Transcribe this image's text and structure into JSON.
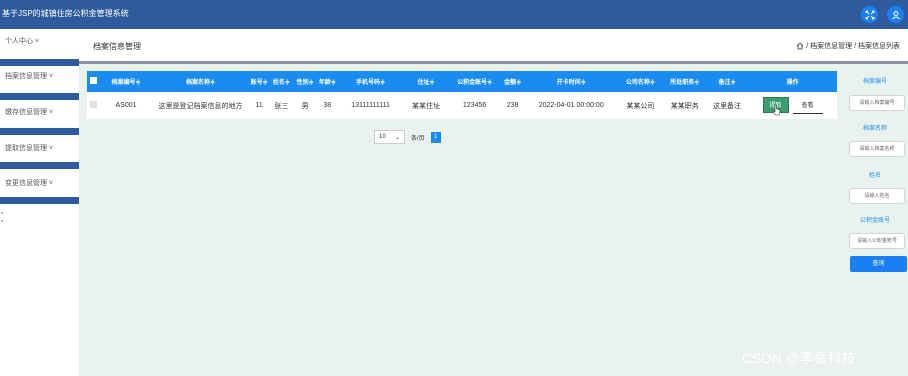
{
  "app": {
    "title": "基于JSP的城镇住房公积金管理系统"
  },
  "sidebar": {
    "items": [
      {
        "label": "个人中心 ˅"
      },
      {
        "label": "档案信息管理 ˅"
      },
      {
        "label": "缴存信息管理 ˅"
      },
      {
        "label": "提取信息管理 ˅"
      },
      {
        "label": "变更信息管理 ˅"
      }
    ]
  },
  "header": {
    "title": "档案信息管理",
    "breadcrumb": "/ 档案信息管理 / 档案信息列表"
  },
  "table": {
    "headers": [
      "档案编号≑",
      "档案名称≑",
      "账号≑",
      "姓名≑",
      "性别≑",
      "年龄≑",
      "手机号码≑",
      "住址≑",
      "公积金账号≑",
      "金额≑",
      "开卡时间≑",
      "公司名称≑",
      "所处职务≑",
      "备注≑",
      "操作"
    ],
    "rows": [
      [
        "AS001",
        "这里是登记档案信息的地方",
        "11",
        "张三",
        "男",
        "38",
        "13111111111",
        "某某住址",
        "123456",
        "238",
        "2022-04-01 00:00:00",
        "某某公司",
        "某某职务",
        "这里备注"
      ]
    ],
    "actions": {
      "select": "提取",
      "view": "查看"
    }
  },
  "pagination": {
    "page_size": "10",
    "page_size_label": "条/页",
    "current_page": "1"
  },
  "search": {
    "fields": [
      {
        "label": "档案编号",
        "placeholder": "请输入档案编号"
      },
      {
        "label": "档案名称",
        "placeholder": "请输入档案名称"
      },
      {
        "label": "姓名",
        "placeholder": "请输入姓名"
      },
      {
        "label": "公积金账号",
        "placeholder": "请输入公积金账号"
      }
    ],
    "button": "查询"
  },
  "watermark": "CSDN @李会科技",
  "colors": {
    "topbar": "#2e5b9e",
    "table_header": "#1a8cf0",
    "accent": "#1a7ff0",
    "select_button": "#3a9e6e",
    "background": "#eaf2ee"
  },
  "icons": {
    "topbar": [
      "fullscreen-icon",
      "user-icon"
    ],
    "breadcrumb": "home-icon"
  }
}
